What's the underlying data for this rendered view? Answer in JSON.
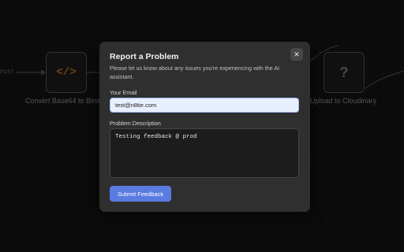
{
  "canvas": {
    "post_label": "POST",
    "nodes": [
      {
        "label": "Convert Base64 to Bina",
        "icon": "code-icon",
        "color": "#d07a2a"
      },
      {
        "label": "Upload to Cloudinary",
        "icon": "question-icon",
        "color": "#8a8a8a"
      }
    ]
  },
  "modal": {
    "title": "Report a Problem",
    "description": "Please let us know about any issues you're experiencing with the AI assistant.",
    "close_label": "✕",
    "email_label": "Your Email",
    "email_value": "test@n8tie.com",
    "problem_label": "Problem Description",
    "problem_value": "Testing feedback @ prod",
    "submit_label": "Submit Feedback"
  },
  "colors": {
    "accent": "#5a7be0",
    "modal_bg": "#2f2f30",
    "canvas_bg": "#141414"
  }
}
